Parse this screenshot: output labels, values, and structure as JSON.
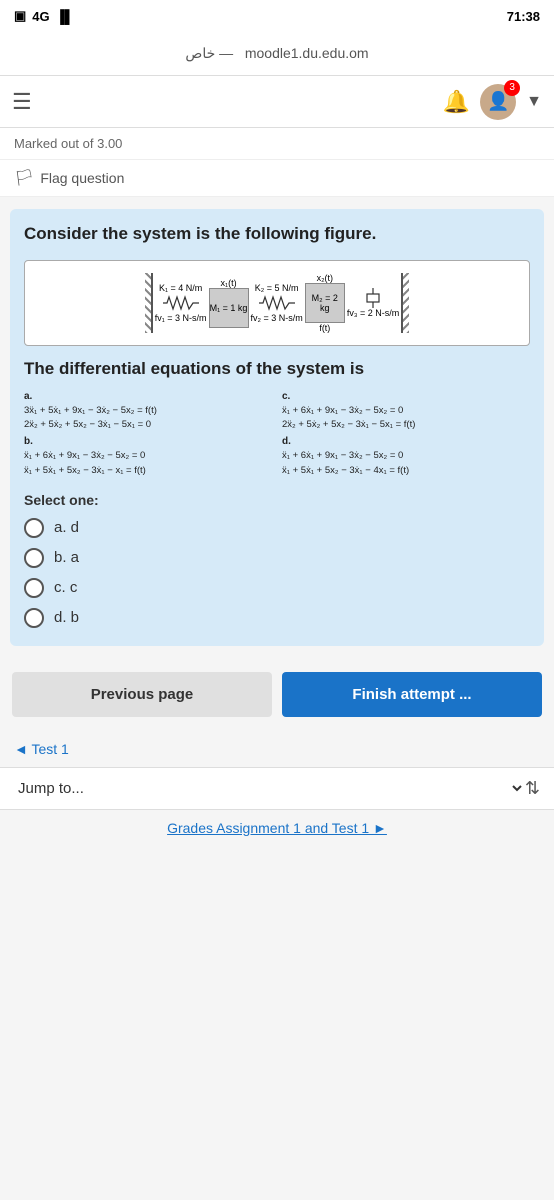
{
  "statusBar": {
    "left": "4G",
    "right": "71:38"
  },
  "navBar": {
    "prefix": "خاص —",
    "title": "moodle1.du.edu.om"
  },
  "appBar": {
    "menuIcon": "☰",
    "bellIcon": "🔔",
    "badge": "3",
    "avatarIcon": "👤",
    "dropdownIcon": "▼"
  },
  "markedOut": "Marked out of 3.00",
  "flagQuestion": "Flag question",
  "question": {
    "intro": "Consider the system is the following figure.",
    "figure": {
      "k1Label": "K₁ = 4 N/m",
      "x1Label": "x₁(t)",
      "k2Label": "K₂ = 5 N/m",
      "x2Label": "x₂(t)",
      "m1Label": "M₁ = 1 kg",
      "m2Label": "M₂ = 2 kg",
      "fv1Label": "fv₁ = 3 N-s/m",
      "fv2Label": "fv₂ = 3 N-s/m",
      "fv3Label": "fv₃ = 2 N-s/m",
      "ftLabel": "f(t)"
    },
    "subtitle": "The differential equations of the system is",
    "options": {
      "a": {
        "label": "a.",
        "eq1": "3ẍ₁ + 5ẋ₁ + 9x₁ − 3ẋ₂ − 5x₂ = f(t)",
        "eq2": "2ẍ₂ + 5ẋ₂ + 5x₂ − 3ẋ₁ − 5x₁ = 0"
      },
      "b": {
        "label": "b.",
        "eq1": "ẍ₁ + 6ẋ₁ + 9x₁ − 3ẋ₂ − 5x₂ = 0",
        "eq2": "ẍ₁ + 5ẋ₁ + 5x₂ − 3ẋ₁ − x₁ = f(t)"
      },
      "c": {
        "label": "c.",
        "eq1": "ẍ₁ + 6ẋ₁ + 9x₁ − 3ẋ₂ − 5x₂ = 0",
        "eq2": "2ẍ₂ + 5ẋ₂ + 5x₂ − 3ẋ₁ − 5x₁ = f(t)"
      },
      "d": {
        "label": "d.",
        "eq1": "ẍ₁ + 6ẋ₁ + 9x₁ − 3ẋ₂ − 5x₂ = 0",
        "eq2": "ẍ₁ + 5ẋ₁ + 5x₂ − 3ẋ₁ − 4x₁ = f(t)"
      }
    },
    "selectOne": "Select one:",
    "radioOptions": [
      {
        "id": "opt-a",
        "label": "a. d"
      },
      {
        "id": "opt-b",
        "label": "b. a"
      },
      {
        "id": "opt-c",
        "label": "c. c"
      },
      {
        "id": "opt-d",
        "label": "d. b"
      }
    ]
  },
  "buttons": {
    "previous": "Previous page",
    "finish": "Finish attempt ..."
  },
  "testLink": "◄ Test 1",
  "jumpTo": "Jump to...",
  "footer": "Grades Assignment 1 and Test 1 ►"
}
